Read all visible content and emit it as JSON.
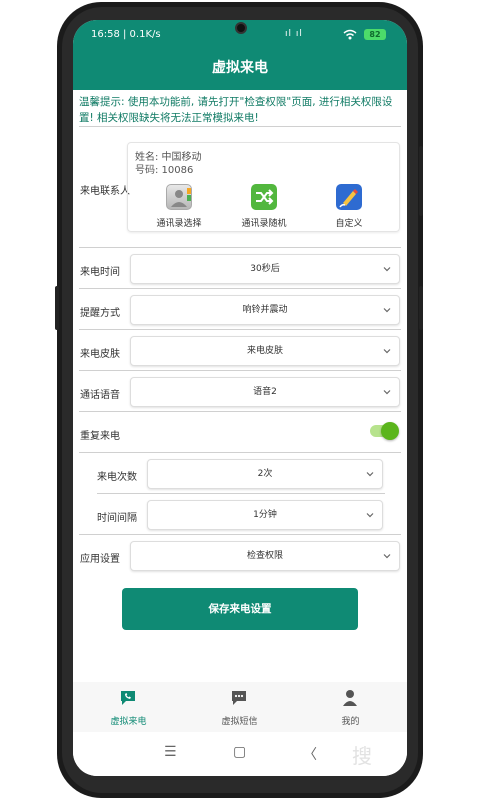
{
  "status_bar": {
    "time": "16:58 | 0.1K/s",
    "signal": "ıl ıl",
    "battery": "82"
  },
  "app_bar": {
    "title": "虚拟来电"
  },
  "notice": "温馨提示: 使用本功能前, 请先打开\"检查权限\"页面, 进行相关权限设置! 相关权限缺失将无法正常模拟来电!",
  "contact": {
    "label": "来电联系人",
    "name": "姓名: 中国移动",
    "number": "号码: 10086",
    "options": [
      {
        "label": "通讯录选择",
        "icon": "contacts-book-icon"
      },
      {
        "label": "通讯录随机",
        "icon": "shuffle-icon"
      },
      {
        "label": "自定义",
        "icon": "edit-pen-icon"
      }
    ]
  },
  "settings": {
    "call_time": {
      "label": "来电时间",
      "value": "30秒后"
    },
    "alert_mode": {
      "label": "提醒方式",
      "value": "响铃并震动"
    },
    "skin": {
      "label": "来电皮肤",
      "value": "来电皮肤"
    },
    "voice": {
      "label": "通话语音",
      "value": "语音2"
    },
    "repeat": {
      "label": "重复来电",
      "enabled": true
    },
    "repeat_count": {
      "label": "来电次数",
      "value": "2次"
    },
    "interval": {
      "label": "时间间隔",
      "value": "1分钟"
    },
    "app_settings": {
      "label": "应用设置",
      "value": "检查权限"
    }
  },
  "save_button": "保存来电设置",
  "bottom_nav": [
    {
      "label": "虚拟来电",
      "icon": "phone-chat-icon",
      "active": true
    },
    {
      "label": "虚拟短信",
      "icon": "sms-icon",
      "active": false
    },
    {
      "label": "我的",
      "icon": "person-icon",
      "active": false
    }
  ],
  "system_nav": {
    "menu": "☰",
    "home": "▢",
    "back": "〈"
  },
  "watermark": "搜",
  "colors": {
    "primary": "#0f8a74",
    "toggle": "#5bb51c"
  }
}
